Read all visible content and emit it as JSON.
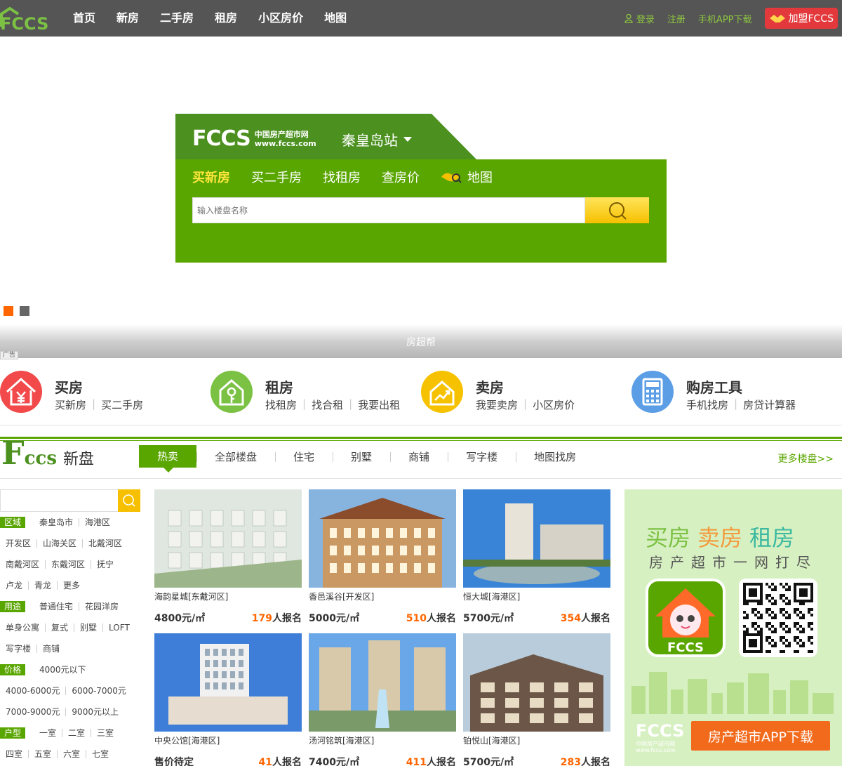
{
  "topbar": {
    "logo_text": "FCCS",
    "nav": [
      "首页",
      "新房",
      "二手房",
      "租房",
      "小区房价",
      "地图"
    ],
    "login": "登录",
    "register": "注册",
    "app_download": "手机APP下载",
    "join": "加盟FCCS"
  },
  "search": {
    "logo_text": "FCCS",
    "logo_cn": "中国房产超市网",
    "logo_url": "www.fccs.com",
    "city": "秦皇岛站",
    "tabs": [
      "买新房",
      "买二手房",
      "找租房",
      "查房价",
      "地图"
    ],
    "placeholder": "输入楼盘名称"
  },
  "banner": {
    "caption": "房超帮",
    "ad_tag": "广告",
    "dots": [
      {
        "color": "#ff6600"
      },
      {
        "color": "#666666"
      }
    ]
  },
  "categories": [
    {
      "title": "买房",
      "links": [
        "买新房",
        "买二手房"
      ],
      "color": "#f24a4a",
      "icon": "yuan-house-icon"
    },
    {
      "title": "租房",
      "links": [
        "找租房",
        "找合租",
        "我要出租"
      ],
      "color": "#7bc143",
      "icon": "key-house-icon"
    },
    {
      "title": "卖房",
      "links": [
        "我要卖房",
        "小区房价"
      ],
      "color": "#f6c200",
      "icon": "chart-house-icon"
    },
    {
      "title": "购房工具",
      "links": [
        "手机找房",
        "房贷计算器"
      ],
      "color": "#5b9ee6",
      "icon": "calculator-icon"
    }
  ],
  "section": {
    "logo_big": "F",
    "logo_small": "ccs",
    "title": "新盘",
    "tabs": [
      "热卖",
      "全部楼盘",
      "住宅",
      "别墅",
      "商铺",
      "写字楼",
      "地图找房"
    ],
    "more": "更多楼盘>>"
  },
  "filter": {
    "rows": [
      {
        "label": "区域",
        "items": [
          "秦皇岛市",
          "海港区"
        ]
      },
      {
        "label": "",
        "items": [
          "开发区",
          "山海关区",
          "北戴河区"
        ]
      },
      {
        "label": "",
        "items": [
          "南戴河区",
          "东戴河区",
          "抚宁"
        ]
      },
      {
        "label": "",
        "items": [
          "卢龙",
          "青龙",
          "更多"
        ]
      },
      {
        "label": "用途",
        "items": [
          "普通住宅",
          "花园洋房"
        ]
      },
      {
        "label": "",
        "items": [
          "单身公寓",
          "复式",
          "别墅",
          "LOFT"
        ]
      },
      {
        "label": "",
        "items": [
          "写字楼",
          "商铺"
        ]
      },
      {
        "label": "价格",
        "items": [
          "4000元以下"
        ]
      },
      {
        "label": "",
        "items": [
          "4000-6000元",
          "6000-7000元"
        ]
      },
      {
        "label": "",
        "items": [
          "7000-9000元",
          "9000元以上"
        ]
      },
      {
        "label": "户型",
        "items": [
          "一室",
          "二室",
          "三室"
        ]
      },
      {
        "label": "",
        "items": [
          "四室",
          "五室",
          "六室",
          "七室"
        ]
      }
    ]
  },
  "listings": [
    {
      "name": "海韵星城[东戴河区]",
      "price": "4800元/㎡",
      "count": "179",
      "suffix": "人报名"
    },
    {
      "name": "香邑溪谷[开发区]",
      "price": "5000元/㎡",
      "count": "510",
      "suffix": "人报名"
    },
    {
      "name": "恒大城[海港区]",
      "price": "5700元/㎡",
      "count": "354",
      "suffix": "人报名"
    },
    {
      "name": "中央公馆[海港区]",
      "price": "售价待定",
      "count": "41",
      "suffix": "人报名"
    },
    {
      "name": "汤河铭筑[海港区]",
      "price": "7400元/㎡",
      "count": "411",
      "suffix": "人报名"
    },
    {
      "name": "铂悦山[海港区]",
      "price": "5700元/㎡",
      "count": "283",
      "suffix": "人报名"
    }
  ],
  "app_ad": {
    "buy": "买房",
    "sell": "卖房",
    "rent": "租房",
    "slogan": "房产超市一网打尽",
    "app_label": "FCCS",
    "download": "房产超市APP下载",
    "logo_text": "FCCS",
    "logo_cn": "中国房产超市网",
    "logo_url": "www.fccs.com",
    "colors": {
      "buy": "#7bc143",
      "sell": "#f39a3c",
      "rent": "#3bb8a0"
    }
  }
}
